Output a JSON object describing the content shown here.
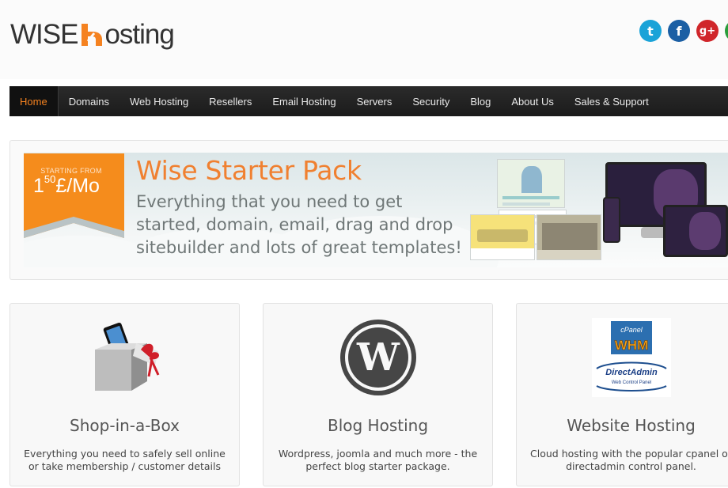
{
  "brand": {
    "word1": "WISE",
    "word2": "osting",
    "colors": {
      "dark": "#333333",
      "accent": "#f58220"
    }
  },
  "social": [
    {
      "name": "twitter-icon",
      "glyph": "t",
      "color": "#1aa3d8"
    },
    {
      "name": "facebook-icon",
      "glyph": "f",
      "color": "#1b5fa4"
    },
    {
      "name": "google-plus-icon",
      "glyph": "g+",
      "color": "#d0262a"
    }
  ],
  "nav": {
    "items": [
      {
        "label": "Home",
        "active": true
      },
      {
        "label": "Domains"
      },
      {
        "label": "Web Hosting"
      },
      {
        "label": "Resellers"
      },
      {
        "label": "Email Hosting"
      },
      {
        "label": "Servers"
      },
      {
        "label": "Security"
      },
      {
        "label": "Blog"
      },
      {
        "label": "About Us"
      },
      {
        "label": "Sales & Support"
      }
    ]
  },
  "banner": {
    "price_label": "STARTING FROM",
    "price_main": "1",
    "price_sup": "50",
    "price_unit": "£/Mo",
    "title": "Wise Starter Pack",
    "text": "Everything that you need to get started, domain, email, drag and drop sitebuilder and lots of great templates!"
  },
  "cards": [
    {
      "title": "Shop-in-a-Box",
      "desc": "Everything you need to safely sell online or take membership / customer details",
      "icon": "gift-box-phone-icon"
    },
    {
      "title": "Blog Hosting",
      "desc": "Wordpress, joomla and much more - the perfect blog starter package.",
      "icon": "wordpress-icon"
    },
    {
      "title": "Website Hosting",
      "desc": "Cloud hosting with the popular cpanel or directadmin control panel.",
      "icon": "cpanel-directadmin-icon"
    }
  ],
  "cpanel": {
    "top": "cPanel",
    "whm": "WHM",
    "da": "DirectAdmin",
    "da_sub": "Web Control Panel"
  }
}
